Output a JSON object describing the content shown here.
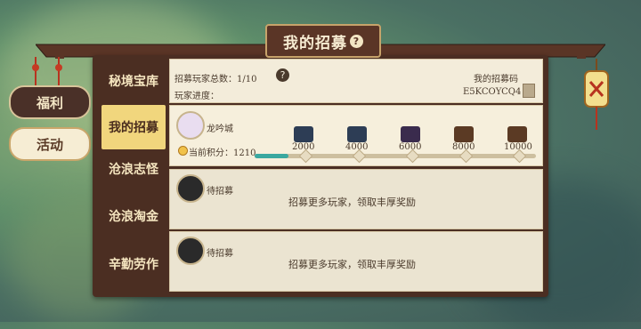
{
  "side_tabs": {
    "welfare": "福利",
    "activity": "活动"
  },
  "title": "我的招募",
  "title_help": "?",
  "nav": [
    "秘境宝库",
    "我的招募",
    "沧浪志怪",
    "沧浪淘金",
    "辛勤劳作"
  ],
  "active_nav": 1,
  "header": {
    "total_label": "招募玩家总数：1/10",
    "help": "?",
    "progress_label": "玩家进度：",
    "code_label": "我的招募码",
    "code_value": "E5KCOYCQ4"
  },
  "recruit": {
    "player_name": "龙吟城",
    "points_label": "当前积分：1210",
    "points": 1210,
    "milestones": [
      "2000",
      "4000",
      "6000",
      "8000",
      "10000"
    ],
    "progress_fraction": 0.12
  },
  "pending": [
    {
      "status": "待招募",
      "message": "招募更多玩家，领取丰厚奖励"
    },
    {
      "status": "待招募",
      "message": "招募更多玩家，领取丰厚奖励"
    }
  ],
  "colors": {
    "frame": "#4b2e22",
    "accent": "#f1d67d",
    "progress": "#3aa8a0"
  },
  "icons": [
    "help-icon",
    "copy-code-icon",
    "avatar-icon",
    "chest-icon",
    "lantern-close-icon",
    "coin-icon"
  ]
}
